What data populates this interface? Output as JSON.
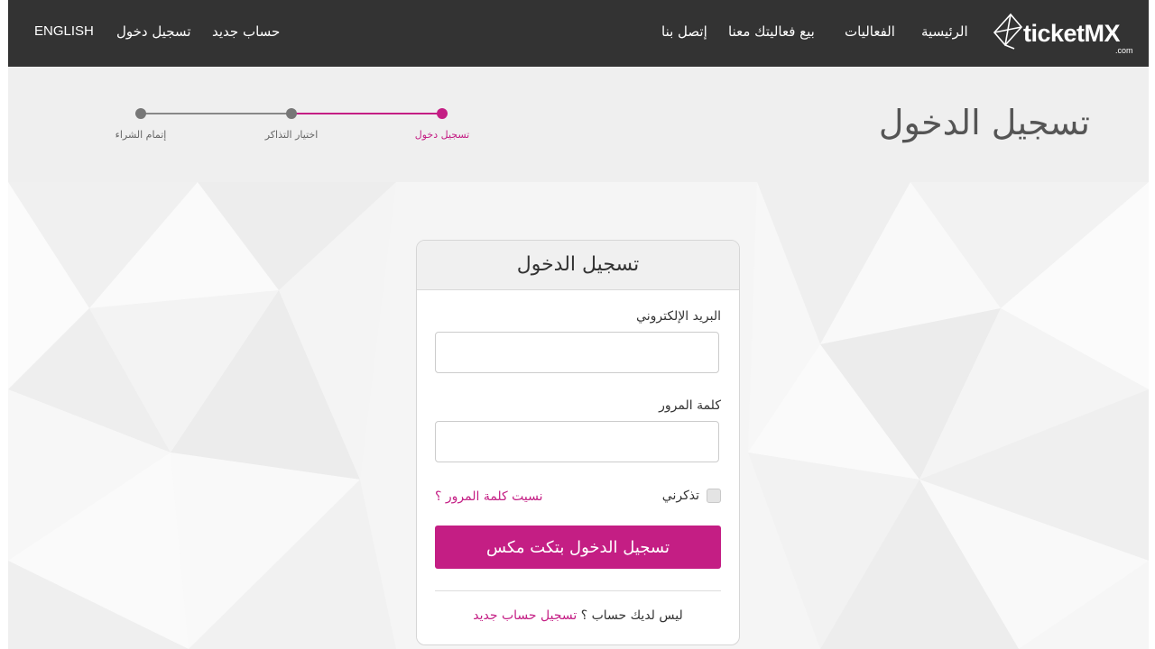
{
  "nav": {
    "items": [
      {
        "label": "الرئيسية"
      },
      {
        "label": "الفعاليات"
      },
      {
        "label": "بيع فعاليتك معنا"
      },
      {
        "label": "إتصل بنا"
      }
    ],
    "register": "حساب جديد",
    "login": "تسجيل دخول",
    "language": "ENGLISH",
    "logo": {
      "word": "ticketMX",
      "suffix": ".com"
    }
  },
  "page_title": "تسجيل الدخول",
  "steps": [
    {
      "label": "تسجيل دخول",
      "state": "active"
    },
    {
      "label": "اختيار التذاكر",
      "state": "pending"
    },
    {
      "label": "إتمام الشراء",
      "state": "pending"
    }
  ],
  "login_card": {
    "title": "تسجيل الدخول",
    "email_label": "البريد الإلكتروني",
    "email_value": "",
    "password_label": "كلمة المرور",
    "password_value": "",
    "remember_label": "تذكرني",
    "remember_checked": false,
    "forgot_label": "نسيت كلمة المرور ؟",
    "submit_label": "تسجيل الدخول بتكت مكس",
    "no_account_text": "ليس لديك حساب ؟",
    "signup_label": "تسجيل حساب جديد"
  },
  "colors": {
    "accent": "#c41e84",
    "navbar": "#333333",
    "header_band": "#efefef"
  }
}
